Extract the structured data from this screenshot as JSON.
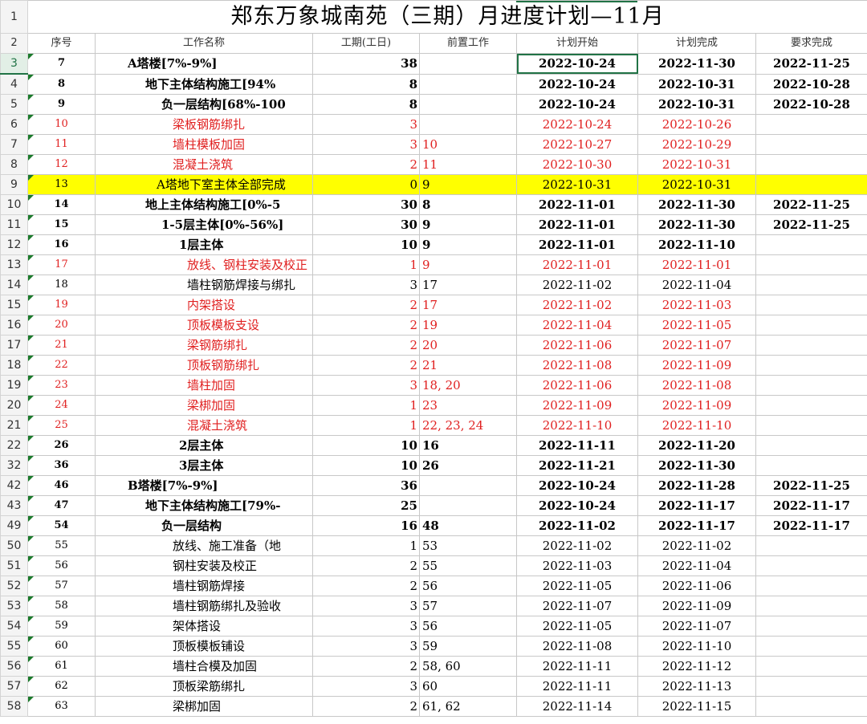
{
  "title": "郑东万象城南苑（三期）月进度计划—11月",
  "title_row_number": "1",
  "header": {
    "row_number": "2",
    "seq": "序号",
    "name": "工作名称",
    "duration": "工期(工日)",
    "predecessor": "前置工作",
    "plan_start": "计划开始",
    "plan_end": "计划完成",
    "required_end": "要求完成"
  },
  "active_row_number": "3",
  "colors": {
    "red_text": "#e02020",
    "highlight": "#ffff00",
    "accent": "#217346"
  },
  "rows": [
    {
      "rn": "3",
      "seq": "7",
      "name": "A塔楼[7%-9%]",
      "indent": 40,
      "dur": "38",
      "pre": "",
      "start": "2022-10-24",
      "end": "2022-11-30",
      "req": "2022-11-25",
      "style": "bold"
    },
    {
      "rn": "4",
      "seq": "8",
      "name": "地下主体结构施工[94%",
      "indent": 62,
      "dur": "8",
      "pre": "",
      "start": "2022-10-24",
      "end": "2022-10-31",
      "req": "2022-10-28",
      "style": "bold"
    },
    {
      "rn": "5",
      "seq": "9",
      "name": "负一层结构[68%-100",
      "indent": 82,
      "dur": "8",
      "pre": "",
      "start": "2022-10-24",
      "end": "2022-10-31",
      "req": "2022-10-28",
      "style": "bold"
    },
    {
      "rn": "6",
      "seq": "10",
      "name": "梁板钢筋绑扎",
      "indent": 96,
      "dur": "3",
      "pre": "",
      "start": "2022-10-24",
      "end": "2022-10-26",
      "req": "",
      "style": "red"
    },
    {
      "rn": "7",
      "seq": "11",
      "name": "墙柱模板加固",
      "indent": 96,
      "dur": "3",
      "pre": "10",
      "start": "2022-10-27",
      "end": "2022-10-29",
      "req": "",
      "style": "red"
    },
    {
      "rn": "8",
      "seq": "12",
      "name": "混凝土浇筑",
      "indent": 96,
      "dur": "2",
      "pre": "11",
      "start": "2022-10-30",
      "end": "2022-10-31",
      "req": "",
      "style": "red"
    },
    {
      "rn": "9",
      "seq": "13",
      "name": "A塔地下室主体全部完成",
      "indent": 76,
      "dur": "0",
      "pre": "9",
      "start": "2022-10-31",
      "end": "2022-10-31",
      "req": "",
      "style": "yellow"
    },
    {
      "rn": "10",
      "seq": "14",
      "name": "地上主体结构施工[0%-5",
      "indent": 62,
      "dur": "30",
      "pre": "8",
      "start": "2022-11-01",
      "end": "2022-11-30",
      "req": "2022-11-25",
      "style": "bold"
    },
    {
      "rn": "11",
      "seq": "15",
      "name": "1-5层主体[0%-56%]",
      "indent": 82,
      "dur": "30",
      "pre": "9",
      "start": "2022-11-01",
      "end": "2022-11-30",
      "req": "2022-11-25",
      "style": "bold"
    },
    {
      "rn": "12",
      "seq": "16",
      "name": "1层主体",
      "indent": 104,
      "dur": "10",
      "pre": "9",
      "start": "2022-11-01",
      "end": "2022-11-10",
      "req": "",
      "style": "bold"
    },
    {
      "rn": "13",
      "seq": "17",
      "name": "放线、钢柱安装及校正",
      "indent": 114,
      "dur": "1",
      "pre": "9",
      "start": "2022-11-01",
      "end": "2022-11-01",
      "req": "",
      "style": "red"
    },
    {
      "rn": "14",
      "seq": "18",
      "name": "墙柱钢筋焊接与绑扎",
      "indent": 114,
      "dur": "3",
      "pre": "17",
      "start": "2022-11-02",
      "end": "2022-11-04",
      "req": "",
      "style": "normal"
    },
    {
      "rn": "15",
      "seq": "19",
      "name": "内架搭设",
      "indent": 114,
      "dur": "2",
      "pre": "17",
      "start": "2022-11-02",
      "end": "2022-11-03",
      "req": "",
      "style": "red"
    },
    {
      "rn": "16",
      "seq": "20",
      "name": "顶板模板支设",
      "indent": 114,
      "dur": "2",
      "pre": "19",
      "start": "2022-11-04",
      "end": "2022-11-05",
      "req": "",
      "style": "red"
    },
    {
      "rn": "17",
      "seq": "21",
      "name": "梁钢筋绑扎",
      "indent": 114,
      "dur": "2",
      "pre": "20",
      "start": "2022-11-06",
      "end": "2022-11-07",
      "req": "",
      "style": "red"
    },
    {
      "rn": "18",
      "seq": "22",
      "name": "顶板钢筋绑扎",
      "indent": 114,
      "dur": "2",
      "pre": "21",
      "start": "2022-11-08",
      "end": "2022-11-09",
      "req": "",
      "style": "red"
    },
    {
      "rn": "19",
      "seq": "23",
      "name": "墙柱加固",
      "indent": 114,
      "dur": "3",
      "pre": "18, 20",
      "start": "2022-11-06",
      "end": "2022-11-08",
      "req": "",
      "style": "red"
    },
    {
      "rn": "20",
      "seq": "24",
      "name": "梁梆加固",
      "indent": 114,
      "dur": "1",
      "pre": "23",
      "start": "2022-11-09",
      "end": "2022-11-09",
      "req": "",
      "style": "red"
    },
    {
      "rn": "21",
      "seq": "25",
      "name": "混凝土浇筑",
      "indent": 114,
      "dur": "1",
      "pre": "22, 23, 24",
      "start": "2022-11-10",
      "end": "2022-11-10",
      "req": "",
      "style": "red"
    },
    {
      "rn": "22",
      "seq": "26",
      "name": "2层主体",
      "indent": 104,
      "dur": "10",
      "pre": "16",
      "start": "2022-11-11",
      "end": "2022-11-20",
      "req": "",
      "style": "bold"
    },
    {
      "rn": "32",
      "seq": "36",
      "name": "3层主体",
      "indent": 104,
      "dur": "10",
      "pre": "26",
      "start": "2022-11-21",
      "end": "2022-11-30",
      "req": "",
      "style": "bold"
    },
    {
      "rn": "42",
      "seq": "46",
      "name": "B塔楼[7%-9%]",
      "indent": 40,
      "dur": "36",
      "pre": "",
      "start": "2022-10-24",
      "end": "2022-11-28",
      "req": "2022-11-25",
      "style": "bold"
    },
    {
      "rn": "43",
      "seq": "47",
      "name": "地下主体结构施工[79%-",
      "indent": 62,
      "dur": "25",
      "pre": "",
      "start": "2022-10-24",
      "end": "2022-11-17",
      "req": "2022-11-17",
      "style": "bold"
    },
    {
      "rn": "49",
      "seq": "54",
      "name": "负一层结构",
      "indent": 82,
      "dur": "16",
      "pre": "48",
      "start": "2022-11-02",
      "end": "2022-11-17",
      "req": "2022-11-17",
      "style": "bold"
    },
    {
      "rn": "50",
      "seq": "55",
      "name": "放线、施工准备（地",
      "indent": 96,
      "dur": "1",
      "pre": "53",
      "start": "2022-11-02",
      "end": "2022-11-02",
      "req": "",
      "style": "normal"
    },
    {
      "rn": "51",
      "seq": "56",
      "name": "钢柱安装及校正",
      "indent": 96,
      "dur": "2",
      "pre": "55",
      "start": "2022-11-03",
      "end": "2022-11-04",
      "req": "",
      "style": "normal"
    },
    {
      "rn": "52",
      "seq": "57",
      "name": "墙柱钢筋焊接",
      "indent": 96,
      "dur": "2",
      "pre": "56",
      "start": "2022-11-05",
      "end": "2022-11-06",
      "req": "",
      "style": "normal"
    },
    {
      "rn": "53",
      "seq": "58",
      "name": "墙柱钢筋绑扎及验收",
      "indent": 96,
      "dur": "3",
      "pre": "57",
      "start": "2022-11-07",
      "end": "2022-11-09",
      "req": "",
      "style": "normal"
    },
    {
      "rn": "54",
      "seq": "59",
      "name": "架体搭设",
      "indent": 96,
      "dur": "3",
      "pre": "56",
      "start": "2022-11-05",
      "end": "2022-11-07",
      "req": "",
      "style": "normal"
    },
    {
      "rn": "55",
      "seq": "60",
      "name": "顶板模板铺设",
      "indent": 96,
      "dur": "3",
      "pre": "59",
      "start": "2022-11-08",
      "end": "2022-11-10",
      "req": "",
      "style": "normal"
    },
    {
      "rn": "56",
      "seq": "61",
      "name": "墙柱合模及加固",
      "indent": 96,
      "dur": "2",
      "pre": "58, 60",
      "start": "2022-11-11",
      "end": "2022-11-12",
      "req": "",
      "style": "normal"
    },
    {
      "rn": "57",
      "seq": "62",
      "name": "顶板梁筋绑扎",
      "indent": 96,
      "dur": "3",
      "pre": "60",
      "start": "2022-11-11",
      "end": "2022-11-13",
      "req": "",
      "style": "normal"
    },
    {
      "rn": "58",
      "seq": "63",
      "name": "梁梆加固",
      "indent": 96,
      "dur": "2",
      "pre": "61, 62",
      "start": "2022-11-14",
      "end": "2022-11-15",
      "req": "",
      "style": "normal"
    }
  ]
}
